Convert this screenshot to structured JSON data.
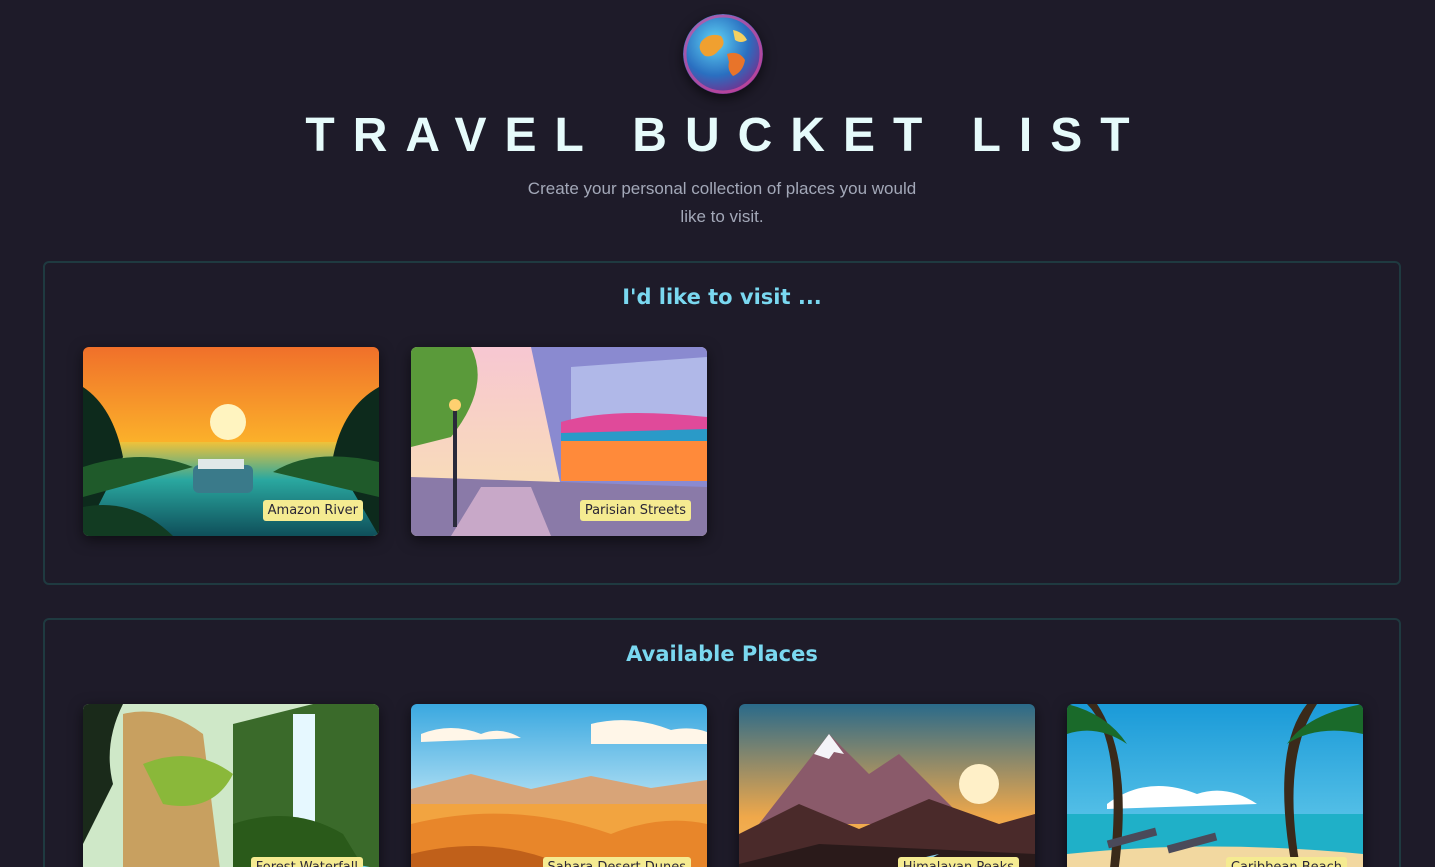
{
  "header": {
    "logo_icon": "globe-icon",
    "title": "TRAVEL BUCKET LIST",
    "subtitle": "Create your personal collection of places you would like to visit."
  },
  "visit_section": {
    "heading": "I'd like to visit ...",
    "places": [
      {
        "name": "Amazon River",
        "image": "jungle-river-sunset"
      },
      {
        "name": "Parisian Streets",
        "image": "paris-street-cafe"
      }
    ]
  },
  "available_section": {
    "heading": "Available Places",
    "places": [
      {
        "name": "Forest Waterfall",
        "image": "forest-waterfall"
      },
      {
        "name": "Sahara Desert Dunes",
        "image": "desert-dunes"
      },
      {
        "name": "Himalayan Peaks",
        "image": "mountain-peaks"
      },
      {
        "name": "Caribbean Beach",
        "image": "palm-beach"
      }
    ]
  },
  "colors": {
    "background": "#1e1b29",
    "heading": "#7ad8f0",
    "title": "#e6fbfb",
    "label_bg": "#f5eb91",
    "border": "#1f3a40"
  }
}
